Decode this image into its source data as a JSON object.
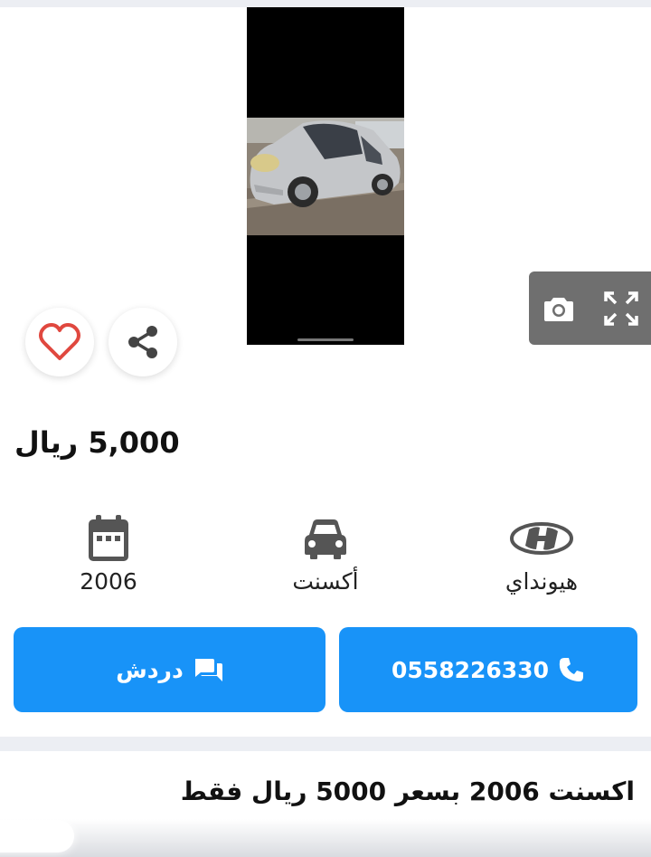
{
  "gallery": {
    "main_photo_icon": "car-photo",
    "camera_icon": "camera-icon",
    "fullscreen_icon": "fullscreen-icon"
  },
  "actions": {
    "favorite_icon": "heart-icon",
    "share_icon": "share-icon"
  },
  "listing": {
    "price": "5,000 ريال",
    "specs": [
      {
        "icon": "calendar-icon",
        "label": "2006"
      },
      {
        "icon": "car-icon",
        "label": "أكسنت"
      },
      {
        "icon": "hyundai-logo",
        "label": "هيونداي"
      }
    ],
    "call_button": {
      "label": "0558226330",
      "icon": "phone-icon"
    },
    "chat_button": {
      "label": "دردش",
      "icon": "chat-icon"
    },
    "headline": "اكسنت 2006 بسعر 5000 ريال فقط"
  },
  "colors": {
    "accent_blue": "#1893f8",
    "heart_red": "#e0483f",
    "overlay_gray": "#6f6f6f",
    "section_gray": "#eceef3"
  }
}
